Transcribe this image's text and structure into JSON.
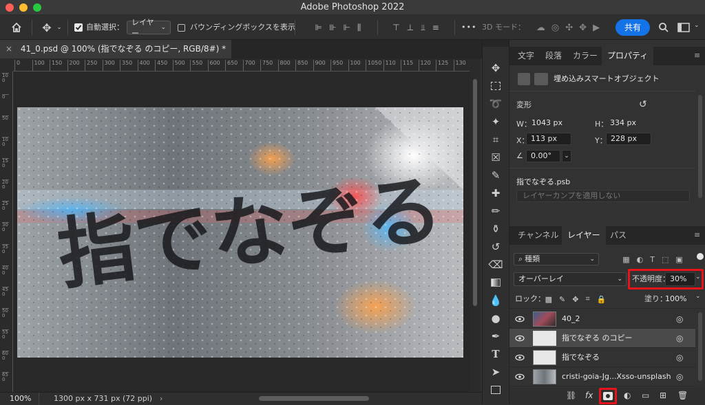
{
  "window": {
    "title": "Adobe Photoshop 2022"
  },
  "options": {
    "auto_select_label": "自動選択：",
    "auto_select_target": "レイヤー",
    "bounding_box_label": "バウンディングボックスを表示",
    "more": "•••",
    "mode3d_label": "3D モード：",
    "share_label": "共有"
  },
  "document": {
    "tab_label": "41_0.psd @ 100% (指でなぞる のコピー, RGB/8#) *",
    "close_glyph": "×",
    "artwork_text": "指でなぞる",
    "ruler_h": [
      "0",
      "100",
      "150",
      "200",
      "250",
      "300",
      "350",
      "400",
      "450",
      "500",
      "550",
      "600",
      "650",
      "700",
      "750",
      "800",
      "850",
      "900",
      "950",
      "100",
      "1050",
      "110",
      "115",
      "120",
      "125",
      "130"
    ],
    "ruler_v": [
      "100",
      "0",
      "50",
      "100",
      "150",
      "200",
      "250",
      "300",
      "350",
      "400",
      "450",
      "500",
      "550",
      "600",
      "650"
    ]
  },
  "status": {
    "zoom": "100%",
    "doc_size": "1300 px x 731 px (72 ppi)",
    "chevron": "›"
  },
  "panel_top": {
    "tabs": [
      "文字",
      "段落",
      "カラー",
      "プロパティ"
    ],
    "active_tab": "プロパティ",
    "object_type": "埋め込みスマートオブジェクト",
    "transform_label": "変形",
    "w_label": "W：",
    "w_value": "1043 px",
    "h_label": "H：",
    "h_value": "334 px",
    "x_label": "X：",
    "x_value": "113 px",
    "y_label": "Y：",
    "y_value": "228 px",
    "angle_value": "0.00°",
    "source_file": "指でなぞる.psb",
    "layer_comp_placeholder": "レイヤーカンプを適用しない"
  },
  "panel_layers": {
    "tabs": [
      "チャンネル",
      "レイヤー",
      "パス"
    ],
    "active_tab": "レイヤー",
    "filter_kind": "種類",
    "blend_mode": "オーバーレイ",
    "opacity_label": "不透明度：",
    "opacity_value": "30%",
    "lock_label": "ロック：",
    "fill_label": "塗り：",
    "fill_value": "100%",
    "layers": [
      {
        "name": "40_2"
      },
      {
        "name": "指でなぞる のコピー"
      },
      {
        "name": "指でなぞる"
      },
      {
        "name": "cristi-goia-Jg...Xsso-unsplash"
      }
    ],
    "bottom_icons": [
      "link-icon",
      "fx-icon",
      "add-mask-icon",
      "adjustment-icon",
      "folder-icon",
      "new-layer-icon",
      "trash-icon"
    ]
  },
  "colors": {
    "accent": "#1473e6",
    "highlight_box": "#e8141a"
  }
}
